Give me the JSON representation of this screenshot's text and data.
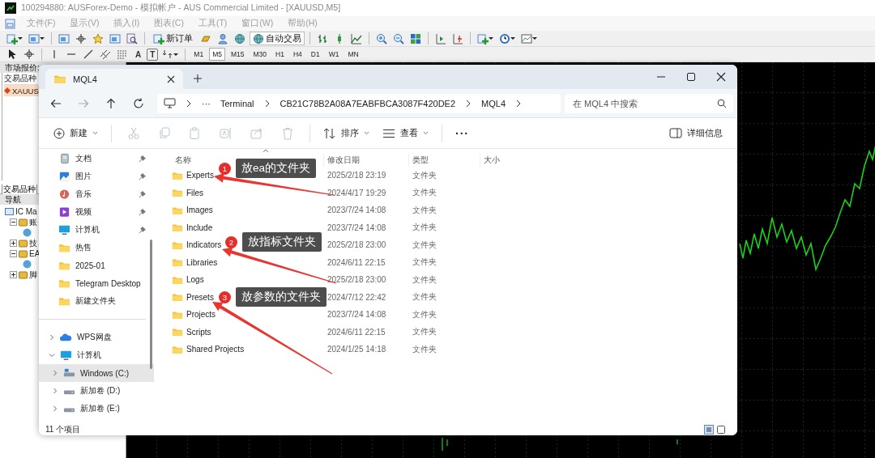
{
  "terminal": {
    "title": "100294880: AUSForex-Demo - 模拟帐户 - AUS Commercial Limited - [XAUUSD,M5]",
    "menu": [
      "文件(F)",
      "显示(V)",
      "插入(I)",
      "图表(C)",
      "工具(T)",
      "窗口(W)",
      "帮助(H)"
    ],
    "toolbar": {
      "new_order": "新订单",
      "auto_trading": {
        "label": "自动交易",
        "on": true
      },
      "text_tools": [
        "A",
        "T"
      ]
    },
    "timeframes": [
      {
        "label": "M1",
        "selected": false
      },
      {
        "label": "M5",
        "selected": true
      },
      {
        "label": "M15",
        "selected": false
      },
      {
        "label": "M30",
        "selected": false
      },
      {
        "label": "H1",
        "selected": false
      },
      {
        "label": "H4",
        "selected": false
      },
      {
        "label": "D1",
        "selected": false
      },
      {
        "label": "W1",
        "selected": false
      },
      {
        "label": "MN",
        "selected": false
      }
    ],
    "market_watch": {
      "title": "市场报价:",
      "column": "交易品种",
      "symbols": [
        {
          "label": "XAUUS",
          "selected": true
        }
      ],
      "tabs": [
        {
          "label": "交易品种",
          "selected": true
        }
      ]
    },
    "navigator": {
      "title": "导航",
      "root": "IC Ma",
      "items": [
        {
          "label": "账",
          "expanded": true
        },
        {
          "label": "技",
          "expanded": false
        },
        {
          "label": "EA",
          "expanded": true
        },
        {
          "label": "脚",
          "expanded": false
        }
      ]
    }
  },
  "explorer": {
    "tabs": [
      {
        "label": "MQL4",
        "selected": true
      }
    ],
    "path": [
      "Terminal",
      "CB21C78B2A08A7EABFBCA3087F420DE2",
      "MQL4"
    ],
    "path_overflow": "···",
    "search": {
      "placeholder": "在 MQL4 中搜索"
    },
    "commands": {
      "new": "新建",
      "actions": [
        {
          "kind": "cut",
          "disabled": true
        },
        {
          "kind": "copy",
          "disabled": true
        },
        {
          "kind": "paste",
          "disabled": true
        },
        {
          "kind": "rename",
          "disabled": true
        },
        {
          "kind": "share",
          "disabled": true
        },
        {
          "kind": "delete",
          "disabled": true
        }
      ],
      "sort": "排序",
      "view": "查看",
      "more": "···",
      "details": "详细信息"
    },
    "sidebar": {
      "quick_access": [
        {
          "label": "文档",
          "kind": "documents",
          "pinned": true,
          "selected": false
        },
        {
          "label": "图片",
          "kind": "pictures",
          "pinned": true,
          "selected": false
        },
        {
          "label": "音乐",
          "kind": "music",
          "pinned": true,
          "selected": false
        },
        {
          "label": "视频",
          "kind": "videos",
          "pinned": true,
          "selected": false
        },
        {
          "label": "计算机",
          "kind": "computer",
          "pinned": true,
          "selected": false
        },
        {
          "label": "热售",
          "kind": "folder",
          "pinned": false,
          "selected": false
        },
        {
          "label": "2025-01",
          "kind": "folder",
          "pinned": false,
          "selected": false
        },
        {
          "label": "Telegram Desktop",
          "kind": "folder",
          "pinned": false,
          "selected": false
        },
        {
          "label": "新建文件夹",
          "kind": "folder",
          "pinned": false,
          "selected": false
        }
      ],
      "tree": [
        {
          "label": "WPS网盘",
          "kind": "cloud",
          "expanded": false,
          "selected": false
        },
        {
          "label": "计算机",
          "kind": "computer",
          "expanded": true,
          "selected": false,
          "children": [
            {
              "label": "Windows (C:)",
              "kind": "system-drive",
              "expanded": false,
              "selected": true
            },
            {
              "label": "新加卷 (D:)",
              "kind": "drive",
              "expanded": false,
              "selected": false
            },
            {
              "label": "新加卷 (E:)",
              "kind": "drive",
              "expanded": false,
              "selected": false
            }
          ]
        }
      ]
    },
    "columns": [
      "名称",
      "修改日期",
      "类型",
      "大小"
    ],
    "rows": [
      {
        "name": "Experts",
        "modified": "2025/2/18 23:19",
        "type": "文件夹",
        "selected": false
      },
      {
        "name": "Files",
        "modified": "2024/4/17 19:29",
        "type": "文件夹",
        "selected": false
      },
      {
        "name": "Images",
        "modified": "2023/7/24 14:08",
        "type": "文件夹",
        "selected": false
      },
      {
        "name": "Include",
        "modified": "2023/7/24 14:08",
        "type": "文件夹",
        "selected": false
      },
      {
        "name": "Indicators",
        "modified": "2025/2/18 23:00",
        "type": "文件夹",
        "selected": false
      },
      {
        "name": "Libraries",
        "modified": "2024/6/11 22:15",
        "type": "文件夹",
        "selected": false
      },
      {
        "name": "Logs",
        "modified": "2025/2/18 23:00",
        "type": "文件夹",
        "selected": false
      },
      {
        "name": "Presets",
        "modified": "2024/7/12 22:42",
        "type": "文件夹",
        "selected": false
      },
      {
        "name": "Projects",
        "modified": "2023/7/24 14:08",
        "type": "文件夹",
        "selected": false
      },
      {
        "name": "Scripts",
        "modified": "2024/6/11 22:15",
        "type": "文件夹",
        "selected": false
      },
      {
        "name": "Shared Projects",
        "modified": "2024/1/25 14:18",
        "type": "文件夹",
        "selected": false
      }
    ],
    "annotations": [
      {
        "number": "1",
        "text": "放ea的文件夹"
      },
      {
        "number": "2",
        "text": "放指标文件夹"
      },
      {
        "number": "3",
        "text": "放参数的文件夹"
      }
    ],
    "status": "11 个项目"
  }
}
